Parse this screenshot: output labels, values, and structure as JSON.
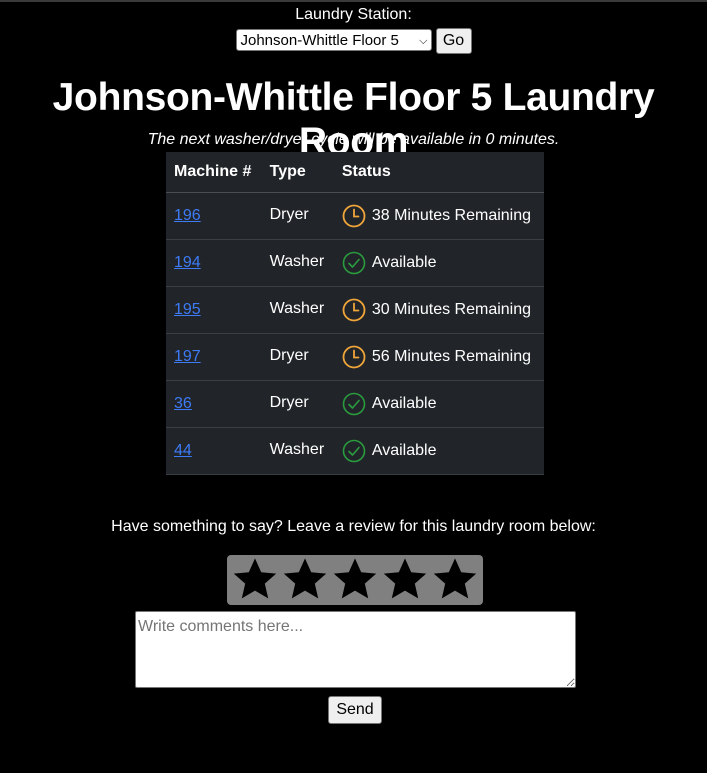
{
  "station": {
    "label": "Laundry Station:",
    "selected": "Johnson-Whittle Floor 5",
    "go_label": "Go"
  },
  "page_title": "Johnson-Whittle Floor 5 Laundry Room",
  "next_cycle": "The next washer/dryer cycle will be available in 0 minutes.",
  "table": {
    "headers": [
      "Machine #",
      "Type",
      "Status"
    ],
    "rows": [
      {
        "machine": "196",
        "type": "Dryer",
        "status": "38 Minutes Remaining",
        "icon": "clock-icon"
      },
      {
        "machine": "194",
        "type": "Washer",
        "status": "Available",
        "icon": "check-circle-icon"
      },
      {
        "machine": "195",
        "type": "Washer",
        "status": "30 Minutes Remaining",
        "icon": "clock-icon"
      },
      {
        "machine": "197",
        "type": "Dryer",
        "status": "56 Minutes Remaining",
        "icon": "clock-icon"
      },
      {
        "machine": "36",
        "type": "Dryer",
        "status": "Available",
        "icon": "check-circle-icon"
      },
      {
        "machine": "44",
        "type": "Washer",
        "status": "Available",
        "icon": "check-circle-icon"
      }
    ]
  },
  "review": {
    "prompt": "Have something to say? Leave a review for this laundry room below:",
    "rating_max": 5,
    "comment_placeholder": "Write comments here...",
    "send_label": "Send"
  },
  "colors": {
    "background": "#000000",
    "table_bg": "#212529",
    "link": "#3d7bf7",
    "busy_icon": "#f0a53a",
    "available_icon": "#2a9c3e",
    "star_panel": "#808080"
  }
}
